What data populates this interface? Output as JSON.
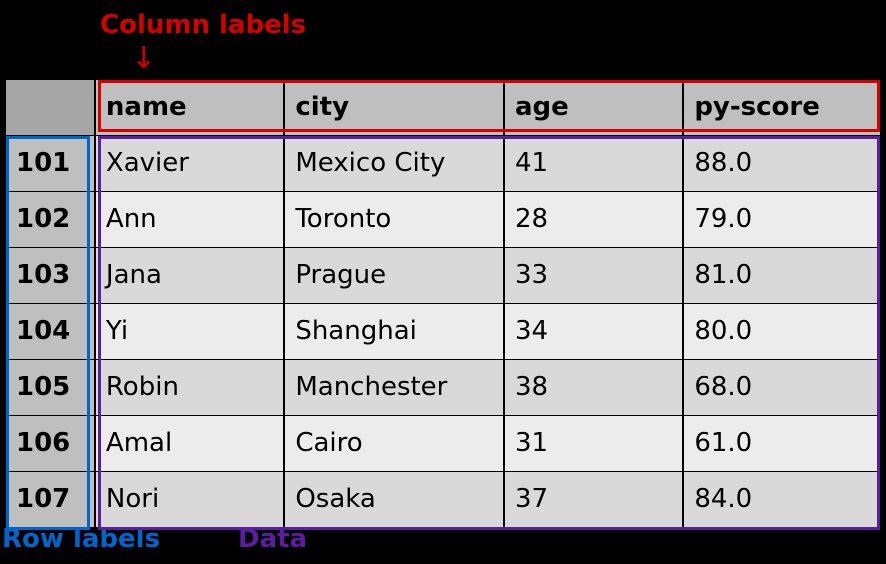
{
  "annotations": {
    "columns": "Column labels",
    "rows": "Row labels",
    "data": "Data"
  },
  "columns": [
    "name",
    "city",
    "age",
    "py-score"
  ],
  "index": [
    "101",
    "102",
    "103",
    "104",
    "105",
    "106",
    "107"
  ],
  "rows": [
    {
      "name": "Xavier",
      "city": "Mexico City",
      "age": "41",
      "py_score": "88.0"
    },
    {
      "name": "Ann",
      "city": "Toronto",
      "age": "28",
      "py_score": "79.0"
    },
    {
      "name": "Jana",
      "city": "Prague",
      "age": "33",
      "py_score": "81.0"
    },
    {
      "name": "Yi",
      "city": "Shanghai",
      "age": "34",
      "py_score": "80.0"
    },
    {
      "name": "Robin",
      "city": "Manchester",
      "age": "38",
      "py_score": "68.0"
    },
    {
      "name": "Amal",
      "city": "Cairo",
      "age": "31",
      "py_score": "61.0"
    },
    {
      "name": "Nori",
      "city": "Osaka",
      "age": "37",
      "py_score": "84.0"
    }
  ],
  "chart_data": {
    "type": "table",
    "columns": [
      "name",
      "city",
      "age",
      "py-score"
    ],
    "index": [
      101,
      102,
      103,
      104,
      105,
      106,
      107
    ],
    "data": [
      [
        "Xavier",
        "Mexico City",
        41,
        88.0
      ],
      [
        "Ann",
        "Toronto",
        28,
        79.0
      ],
      [
        "Jana",
        "Prague",
        33,
        81.0
      ],
      [
        "Yi",
        "Shanghai",
        34,
        80.0
      ],
      [
        "Robin",
        "Manchester",
        38,
        68.0
      ],
      [
        "Amal",
        "Cairo",
        31,
        61.0
      ],
      [
        "Nori",
        "Osaka",
        37,
        84.0
      ]
    ]
  }
}
